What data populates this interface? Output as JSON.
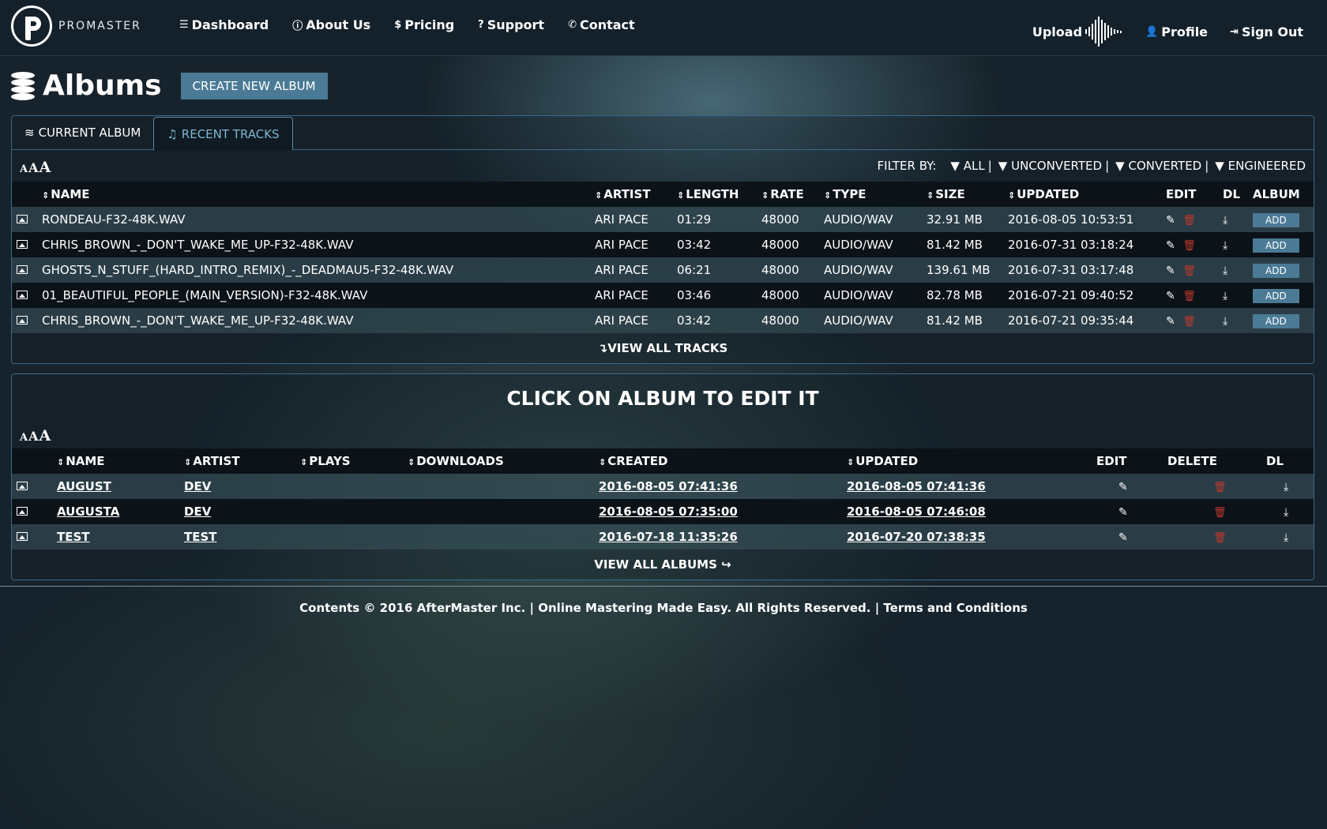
{
  "brand": {
    "name": "PROMASTER"
  },
  "nav": {
    "links": [
      {
        "label": "Dashboard",
        "icon": "sliders-icon"
      },
      {
        "label": "About Us",
        "icon": "info-icon"
      },
      {
        "label": "Pricing",
        "icon": "dollar-icon"
      },
      {
        "label": "Support",
        "icon": "question-icon"
      },
      {
        "label": "Contact",
        "icon": "phone-icon"
      }
    ],
    "upload_label": "Upload",
    "profile_label": "Profile",
    "signout_label": "Sign Out"
  },
  "page": {
    "title": "Albums",
    "create_button": "CREATE NEW ALBUM"
  },
  "tabs": [
    {
      "label": "CURRENT ALBUM",
      "active": false
    },
    {
      "label": "RECENT TRACKS",
      "active": true
    }
  ],
  "filters": {
    "label": "FILTER BY:",
    "options": [
      "ALL",
      "UNCONVERTED",
      "CONVERTED",
      "ENGINEERED"
    ]
  },
  "tracks": {
    "columns": [
      "NAME",
      "ARTIST",
      "LENGTH",
      "RATE",
      "TYPE",
      "SIZE",
      "UPDATED",
      "EDIT",
      "DL",
      "ALBUM"
    ],
    "add_label": "ADD",
    "rows": [
      {
        "name": "RONDEAU-F32-48K.WAV",
        "artist": "ARI PACE",
        "length": "01:29",
        "rate": "48000",
        "type": "AUDIO/WAV",
        "size": "32.91 MB",
        "updated": "2016-08-05 10:53:51"
      },
      {
        "name": "CHRIS_BROWN_-_DON'T_WAKE_ME_UP-F32-48K.WAV",
        "artist": "ARI PACE",
        "length": "03:42",
        "rate": "48000",
        "type": "AUDIO/WAV",
        "size": "81.42 MB",
        "updated": "2016-07-31 03:18:24"
      },
      {
        "name": "GHOSTS_N_STUFF_(HARD_INTRO_REMIX)_-_DEADMAU5-F32-48K.WAV",
        "artist": "ARI PACE",
        "length": "06:21",
        "rate": "48000",
        "type": "AUDIO/WAV",
        "size": "139.61 MB",
        "updated": "2016-07-31 03:17:48"
      },
      {
        "name": "01_BEAUTIFUL_PEOPLE_(MAIN_VERSION)-F32-48K.WAV",
        "artist": "ARI PACE",
        "length": "03:46",
        "rate": "48000",
        "type": "AUDIO/WAV",
        "size": "82.78 MB",
        "updated": "2016-07-21 09:40:52"
      },
      {
        "name": "CHRIS_BROWN_-_DON'T_WAKE_ME_UP-F32-48K.WAV",
        "artist": "ARI PACE",
        "length": "03:42",
        "rate": "48000",
        "type": "AUDIO/WAV",
        "size": "81.42 MB",
        "updated": "2016-07-21 09:35:44"
      }
    ],
    "view_all": "VIEW ALL TRACKS"
  },
  "albums": {
    "heading": "CLICK ON ALBUM TO EDIT IT",
    "columns": [
      "NAME",
      "ARTIST",
      "PLAYS",
      "DOWNLOADS",
      "CREATED",
      "UPDATED",
      "EDIT",
      "DELETE",
      "DL"
    ],
    "rows": [
      {
        "name": "AUGUST",
        "artist": "DEV",
        "plays": "",
        "downloads": "",
        "created": "2016-08-05 07:41:36",
        "updated": "2016-08-05 07:41:36"
      },
      {
        "name": "AUGUSTA",
        "artist": "DEV",
        "plays": "",
        "downloads": "",
        "created": "2016-08-05 07:35:00",
        "updated": "2016-08-05 07:46:08"
      },
      {
        "name": "TEST",
        "artist": "TEST",
        "plays": "",
        "downloads": "",
        "created": "2016-07-18 11:35:26",
        "updated": "2016-07-20 07:38:35"
      }
    ],
    "view_all": "VIEW ALL ALBUMS"
  },
  "footer": {
    "text": "Contents © 2016 AfterMaster Inc. | Online Mastering Made Easy. All Rights Reserved. | Terms and Conditions"
  },
  "colors": {
    "accent": "#4a7a95",
    "delete": "#c0392b",
    "panel_border": "#3a6a86"
  }
}
